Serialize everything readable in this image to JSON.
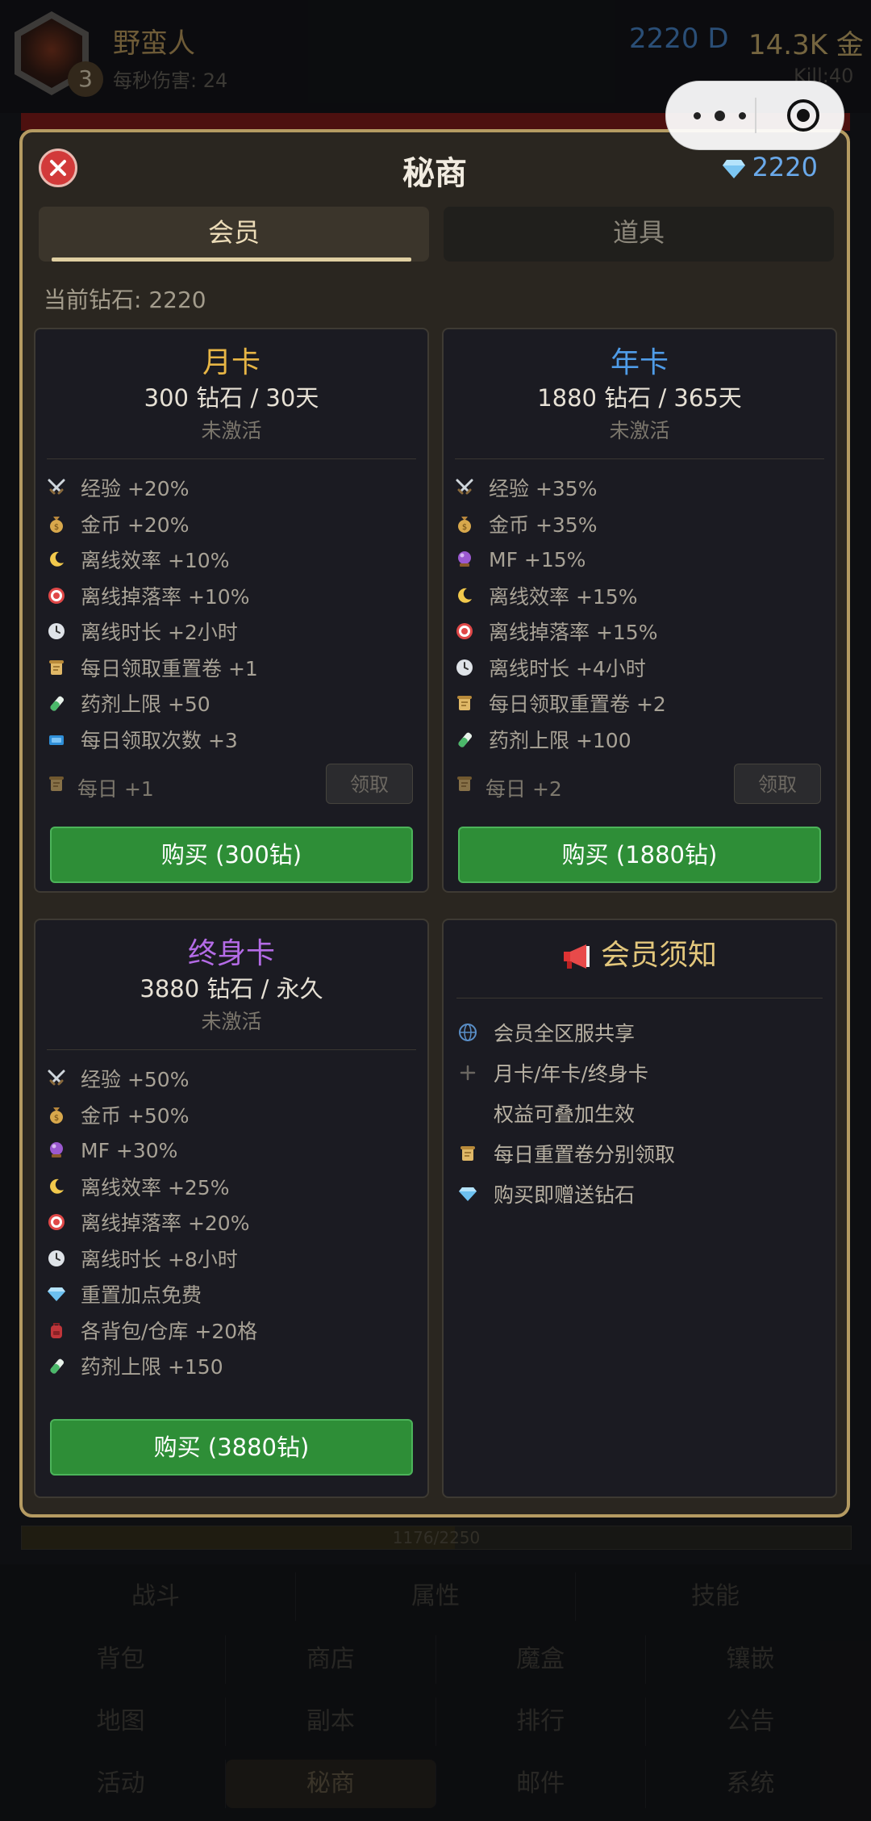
{
  "hud": {
    "avatar_level": "3",
    "hero_name": "野蛮人",
    "dps_text": "每秒伤害: 24",
    "currency_d": "2220 D",
    "currency_gold": "14.3K 金",
    "kill_text": "Kill:40"
  },
  "modal": {
    "title": "秘商",
    "balance": "2220",
    "tabs": [
      {
        "label": "会员",
        "active": true
      },
      {
        "label": "道具",
        "active": false
      }
    ],
    "current_diamonds": "当前钻石: 2220"
  },
  "cards": {
    "monthly": {
      "title": "月卡",
      "title_color": "#e8b645",
      "price": "300 钻石 / 30天",
      "status": "未激活",
      "perks": [
        {
          "icon": "crossed-swords-icon",
          "text": "经验 +20%"
        },
        {
          "icon": "money-bag-icon",
          "text": "金币 +20%"
        },
        {
          "icon": "crescent-moon-icon",
          "text": "离线效率 +10%"
        },
        {
          "icon": "target-icon",
          "text": "离线掉落率 +10%"
        },
        {
          "icon": "clock-icon",
          "text": "离线时长 +2小时"
        },
        {
          "icon": "scroll-icon",
          "text": "每日领取重置卷 +1"
        },
        {
          "icon": "potion-icon",
          "text": "药剂上限 +50"
        },
        {
          "icon": "ticket-icon",
          "text": "每日领取次数 +3"
        }
      ],
      "daily_text": "每日 +1",
      "claim_label": "领取",
      "buy_label": "购买 (300钻)"
    },
    "yearly": {
      "title": "年卡",
      "title_color": "#4f9ce8",
      "price": "1880 钻石 / 365天",
      "status": "未激活",
      "perks": [
        {
          "icon": "crossed-swords-icon",
          "text": "经验 +35%"
        },
        {
          "icon": "money-bag-icon",
          "text": "金币 +35%"
        },
        {
          "icon": "crystal-ball-icon",
          "text": "MF +15%"
        },
        {
          "icon": "crescent-moon-icon",
          "text": "离线效率 +15%"
        },
        {
          "icon": "target-icon",
          "text": "离线掉落率 +15%"
        },
        {
          "icon": "clock-icon",
          "text": "离线时长 +4小时"
        },
        {
          "icon": "scroll-icon",
          "text": "每日领取重置卷 +2"
        },
        {
          "icon": "potion-icon",
          "text": "药剂上限 +100"
        }
      ],
      "daily_text": "每日 +2",
      "claim_label": "领取",
      "buy_label": "购买 (1880钻)"
    },
    "lifetime": {
      "title": "终身卡",
      "title_color": "#b46be6",
      "price": "3880 钻石 / 永久",
      "status": "未激活",
      "perks": [
        {
          "icon": "crossed-swords-icon",
          "text": "经验 +50%"
        },
        {
          "icon": "money-bag-icon",
          "text": "金币 +50%"
        },
        {
          "icon": "crystal-ball-icon",
          "text": "MF +30%"
        },
        {
          "icon": "crescent-moon-icon",
          "text": "离线效率 +25%"
        },
        {
          "icon": "target-icon",
          "text": "离线掉落率 +20%"
        },
        {
          "icon": "clock-icon",
          "text": "离线时长 +8小时"
        },
        {
          "icon": "gem-icon",
          "text": "重置加点免费"
        },
        {
          "icon": "backpack-icon",
          "text": "各背包/仓库 +20格"
        },
        {
          "icon": "potion-icon",
          "text": "药剂上限 +150"
        }
      ],
      "buy_label": "购买 (3880钻)"
    },
    "notice": {
      "title": "会员须知",
      "items": [
        {
          "icon": "globe-icon",
          "text": "会员全区服共享"
        },
        {
          "icon": "plus-icon",
          "text": "月卡/年卡/终身卡"
        },
        {
          "icon": "",
          "text": "权益可叠加生效"
        },
        {
          "icon": "scroll-icon",
          "text": "每日重置卷分别领取"
        },
        {
          "icon": "gem-icon",
          "text": "购买即赠送钻石"
        }
      ]
    }
  },
  "progress": {
    "text": "1176/2250",
    "value": 1176,
    "max": 2250
  },
  "bottom_nav": {
    "row1": [
      "战斗",
      "属性",
      "技能"
    ],
    "row2": [
      "背包",
      "商店",
      "魔盒",
      "镶嵌"
    ],
    "row3": [
      "地图",
      "副本",
      "排行",
      "公告"
    ],
    "row4": [
      "活动",
      "秘商",
      "邮件",
      "系统"
    ],
    "active": "秘商"
  }
}
